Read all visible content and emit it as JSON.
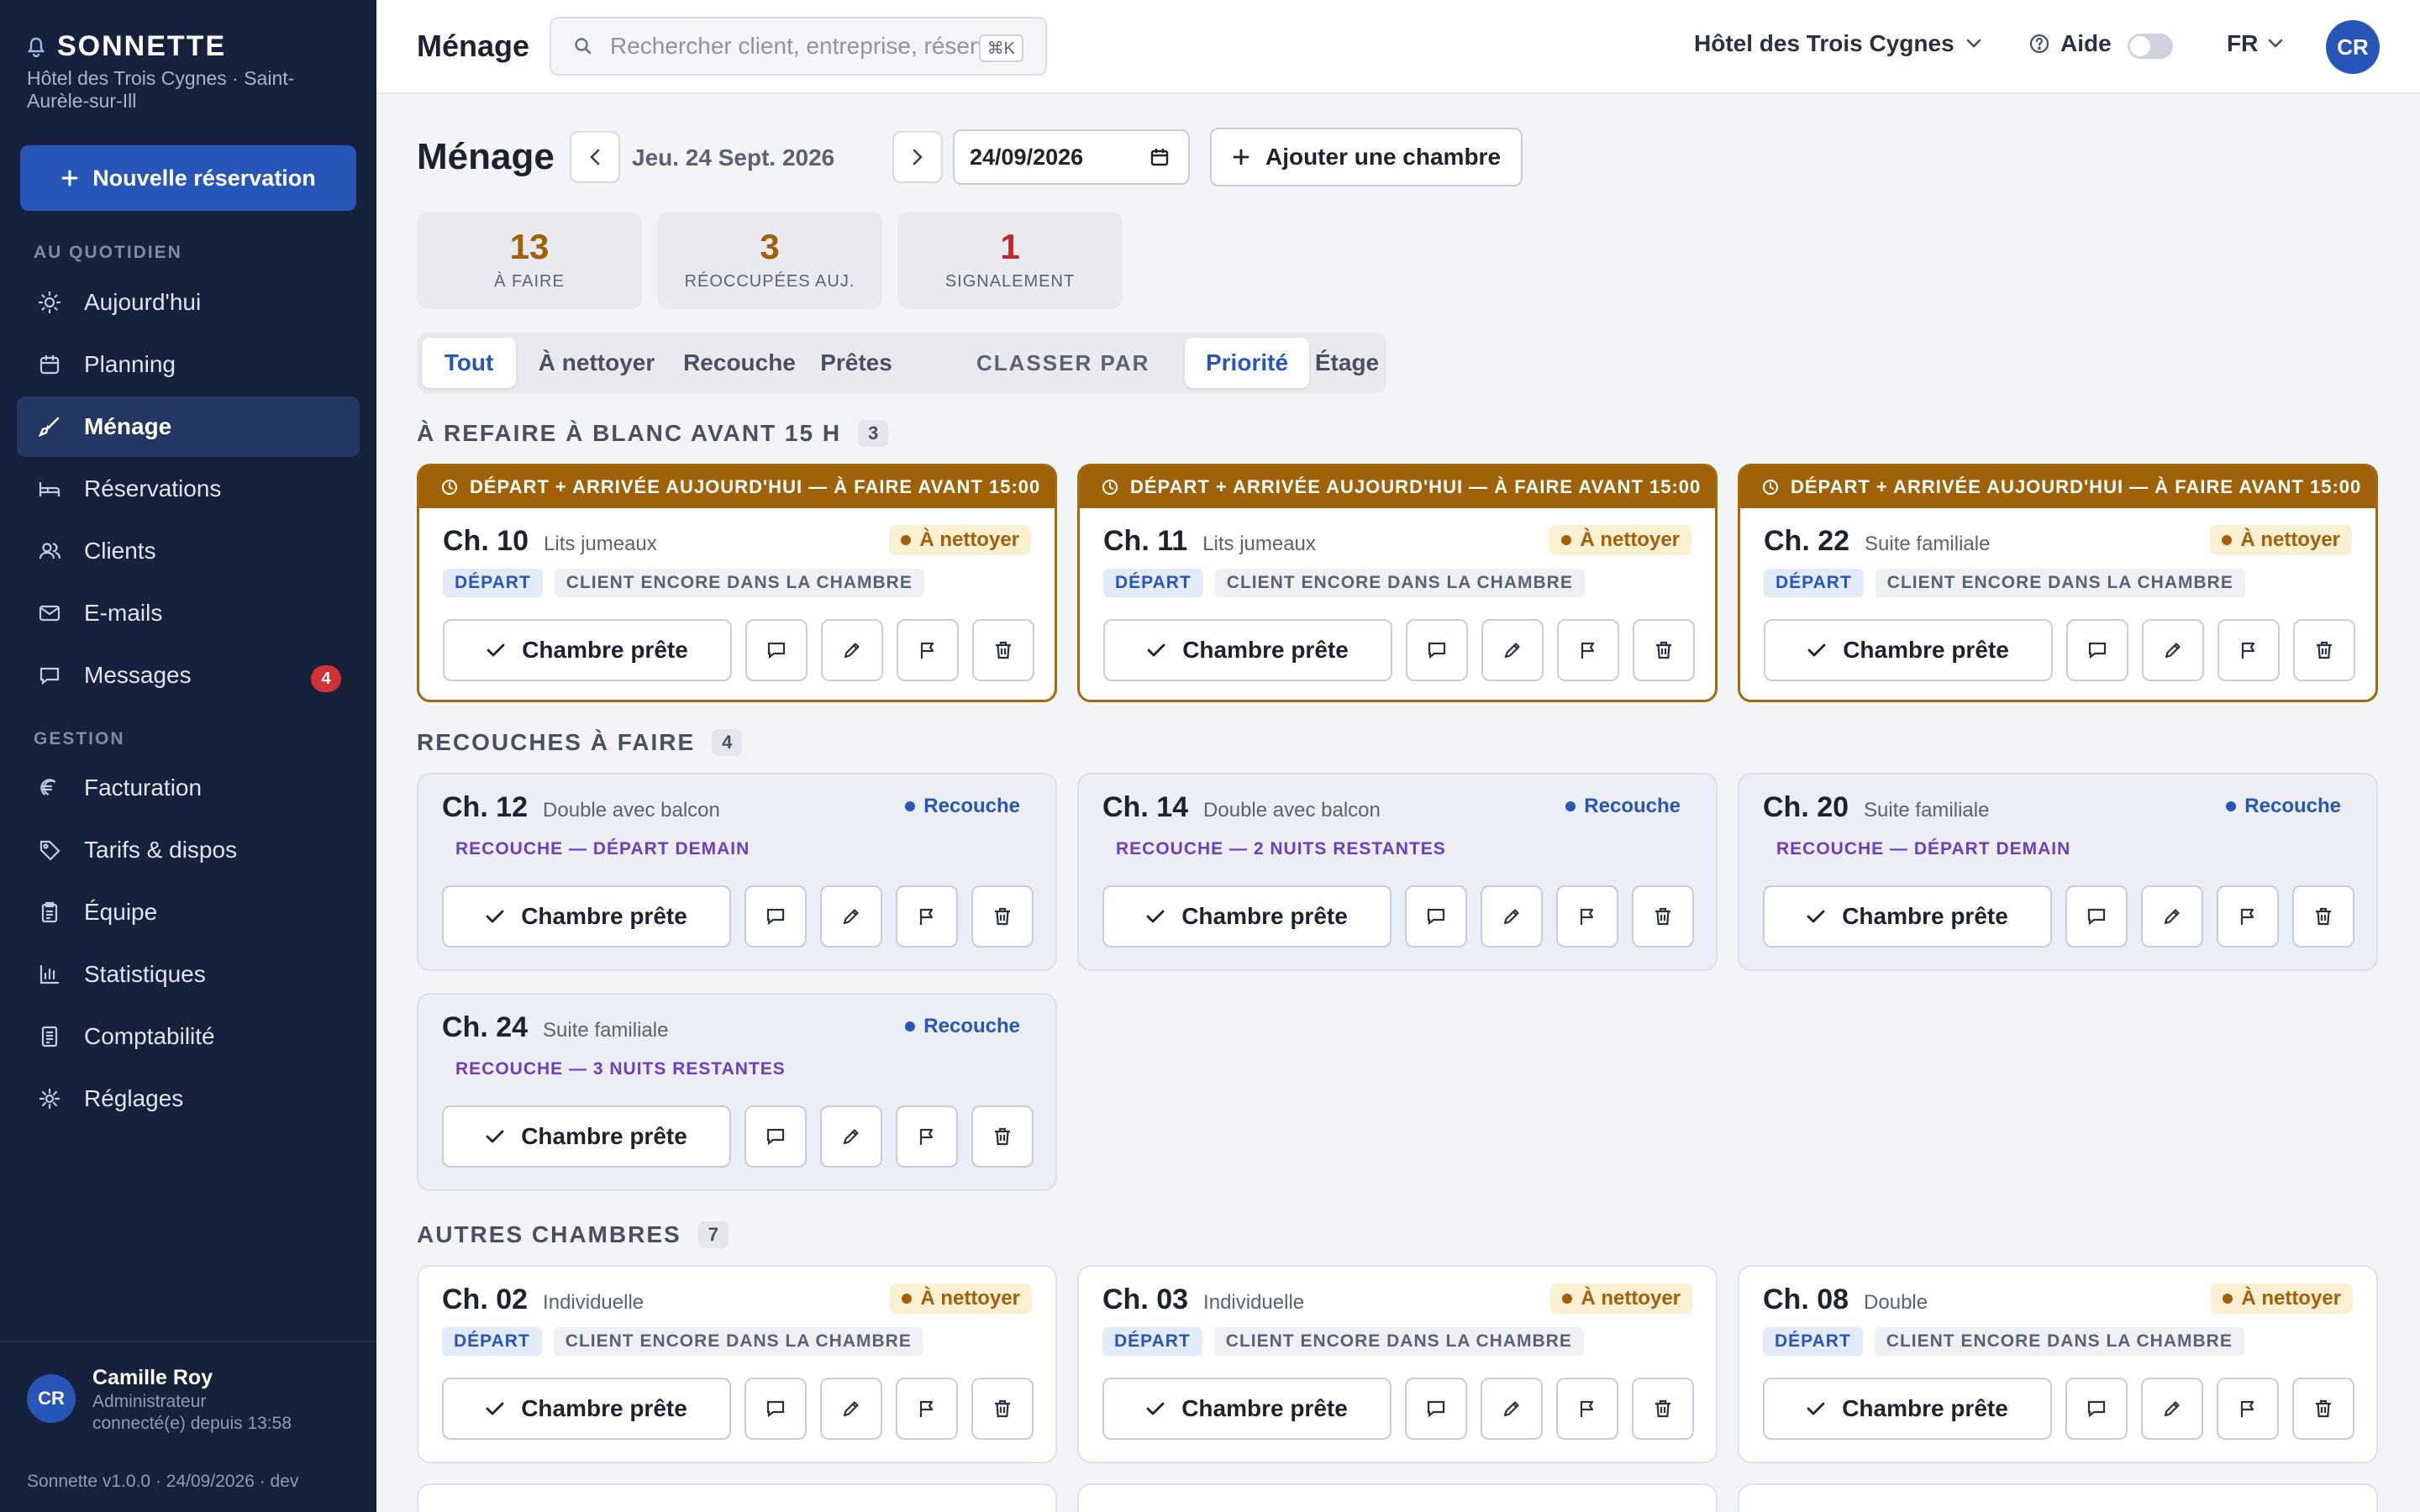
{
  "brand": {
    "name": "SONNETTE",
    "subtitle": "Hôtel des Trois Cygnes · Saint-Aurèle-sur-Ill"
  },
  "sidebar": {
    "new_reservation": "Nouvelle réservation",
    "section_daily": "AU QUOTIDIEN",
    "section_management": "GESTION",
    "items": [
      {
        "label": "Aujourd'hui",
        "icon": "sun-icon"
      },
      {
        "label": "Planning",
        "icon": "calendar-icon"
      },
      {
        "label": "Ménage",
        "icon": "broom-icon",
        "active": true
      },
      {
        "label": "Réservations",
        "icon": "bed-icon"
      },
      {
        "label": "Clients",
        "icon": "users-icon"
      },
      {
        "label": "E-mails",
        "icon": "mail-icon"
      },
      {
        "label": "Messages",
        "icon": "chat-icon",
        "badge": "4"
      },
      {
        "label": "Facturation",
        "icon": "euro-icon"
      },
      {
        "label": "Tarifs & dispos",
        "icon": "tag-icon"
      },
      {
        "label": "Équipe",
        "icon": "clipboard-icon"
      },
      {
        "label": "Statistiques",
        "icon": "bar-chart-icon"
      },
      {
        "label": "Comptabilité",
        "icon": "ledger-icon"
      },
      {
        "label": "Réglages",
        "icon": "gear-icon"
      }
    ],
    "user": {
      "initials": "CR",
      "name": "Camille Roy",
      "role": "Administrateur",
      "since": "connecté(e) depuis 13:58"
    },
    "version": "Sonnette v1.0.0 · 24/09/2026 · dev"
  },
  "topbar": {
    "title": "Ménage",
    "search_placeholder": "Rechercher client, entreprise, réservation…",
    "search_shortcut": "⌘K",
    "hotel": "Hôtel des Trois Cygnes",
    "help": "Aide",
    "lang": "FR",
    "avatar": "CR"
  },
  "page": {
    "title": "Ménage",
    "date_label": "Jeu. 24 Sept. 2026",
    "date_value": "24/09/2026",
    "add_room": "Ajouter une chambre",
    "stats": [
      {
        "value": "13",
        "label": "À FAIRE",
        "color": "#a45f0a"
      },
      {
        "value": "3",
        "label": "RÉOCCUPÉES AUJ.",
        "color": "#a45f0a"
      },
      {
        "value": "1",
        "label": "SIGNALEMENT",
        "color": "#c0282d"
      }
    ],
    "filters": [
      "Tout",
      "À nettoyer",
      "Recouche",
      "Prêtes"
    ],
    "sort_label": "CLASSER PAR",
    "sort_options": [
      "Priorité",
      "Étage"
    ]
  },
  "labels": {
    "urgent_banner": "DÉPART + ARRIVÉE AUJOURD'HUI — À FAIRE AVANT 15:00",
    "ready_button": "Chambre prête",
    "status_todo": "À nettoyer",
    "status_recouche": "Recouche",
    "tag_departure": "DÉPART",
    "tag_client": "CLIENT ENCORE DANS LA CHAMBRE"
  },
  "groups": [
    {
      "title": "À REFAIRE À BLANC AVANT 15 H",
      "count": "3"
    },
    {
      "title": "RECOUCHES À FAIRE",
      "count": "4"
    },
    {
      "title": "AUTRES CHAMBRES",
      "count": "7"
    }
  ],
  "urgent_rooms": [
    {
      "name": "Ch. 10",
      "type": "Lits jumeaux"
    },
    {
      "name": "Ch. 11",
      "type": "Lits jumeaux"
    },
    {
      "name": "Ch. 22",
      "type": "Suite familiale"
    }
  ],
  "recouche_rooms": [
    {
      "name": "Ch. 12",
      "type": "Double avec balcon",
      "note": "RECOUCHE — DÉPART DEMAIN"
    },
    {
      "name": "Ch. 14",
      "type": "Double avec balcon",
      "note": "RECOUCHE — 2 NUITS RESTANTES"
    },
    {
      "name": "Ch. 20",
      "type": "Suite familiale",
      "note": "RECOUCHE — DÉPART DEMAIN"
    },
    {
      "name": "Ch. 24",
      "type": "Suite familiale",
      "note": "RECOUCHE — 3 NUITS RESTANTES"
    }
  ],
  "other_rooms": [
    {
      "name": "Ch. 02",
      "type": "Individuelle"
    },
    {
      "name": "Ch. 03",
      "type": "Individuelle"
    },
    {
      "name": "Ch. 08",
      "type": "Double"
    }
  ]
}
